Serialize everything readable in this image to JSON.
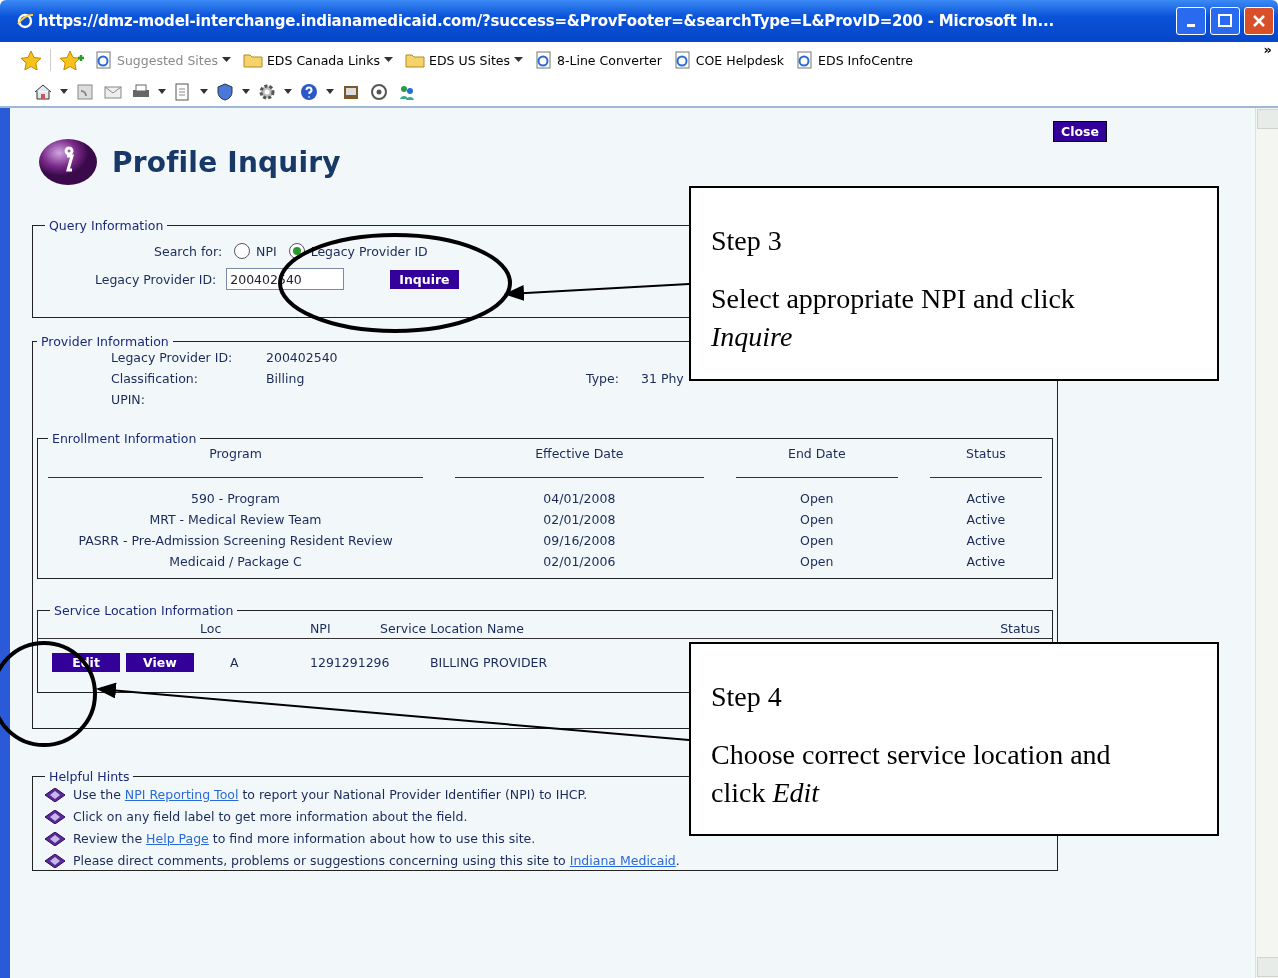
{
  "window": {
    "title": "https://dmz-model-interchange.indianamedicaid.com/?success=&ProvFooter=&searchType=L&ProvID=200 - Microsoft In..."
  },
  "favorites_bar": {
    "items": [
      {
        "label": "Suggested Sites",
        "kind": "page",
        "menu": true,
        "disabled": true
      },
      {
        "label": "EDS Canada Links",
        "kind": "folder",
        "menu": true,
        "disabled": false
      },
      {
        "label": "EDS US Sites",
        "kind": "folder",
        "menu": true,
        "disabled": false
      },
      {
        "label": "8-Line Converter",
        "kind": "page",
        "menu": false,
        "disabled": false
      },
      {
        "label": "COE Helpdesk",
        "kind": "page",
        "menu": false,
        "disabled": false
      },
      {
        "label": "EDS InfoCentre",
        "kind": "page",
        "menu": false,
        "disabled": false
      }
    ],
    "overflow": "»"
  },
  "page": {
    "title": "Profile Inquiry",
    "close_button": "Close",
    "query": {
      "legend": "Query Information",
      "search_for_label": "Search for:",
      "radios": [
        {
          "label": "NPI",
          "selected": false
        },
        {
          "label": "Legacy Provider ID",
          "selected": true
        }
      ],
      "field_label": "Legacy Provider ID:",
      "field_value": "200402540",
      "button": "Inquire"
    },
    "provider": {
      "legend": "Provider Information",
      "fields": [
        {
          "label": "Legacy Provider ID:",
          "value": "200402540"
        },
        {
          "label": "Classification:",
          "value": "Billing"
        },
        {
          "label": "UPIN:"
        }
      ],
      "type_label": "Type:",
      "type_value": "31 Phy"
    },
    "enrollment": {
      "legend": "Enrollment Information",
      "columns": [
        "Program",
        "Effective Date",
        "End Date",
        "Status"
      ],
      "rows": [
        [
          "590 - Program",
          "04/01/2008",
          "Open",
          "Active"
        ],
        [
          "MRT - Medical Review Team",
          "02/01/2008",
          "Open",
          "Active"
        ],
        [
          "PASRR - Pre-Admission Screening Resident Review",
          "09/16/2008",
          "Open",
          "Active"
        ],
        [
          "Medicaid / Package C",
          "02/01/2006",
          "Open",
          "Active"
        ]
      ]
    },
    "service_location": {
      "legend": "Service Location Information",
      "columns": [
        "Loc",
        "NPI",
        "Service Location Name",
        "Status"
      ],
      "rows": [
        {
          "buttons": [
            "Edit",
            "View"
          ],
          "loc": "A",
          "npi": "1291291296",
          "name": "BILLING PROVIDER"
        }
      ]
    },
    "hints": {
      "legend": "Helpful Hints",
      "items": [
        [
          {
            "text": "Use the "
          },
          {
            "link": "NPI Reporting Tool"
          },
          {
            "text": " to report your National Provider Identifier (NPI) to IHCP."
          }
        ],
        [
          {
            "text": "Click on any field label to get more information about  the field."
          }
        ],
        [
          {
            "text": "Review the "
          },
          {
            "link": "Help Page"
          },
          {
            "text": " to find more information about how to use this site."
          }
        ],
        [
          {
            "text": "Please direct comments, problems or suggestions concerning using this site to "
          },
          {
            "link": "Indiana Medicaid"
          },
          {
            "text": "."
          }
        ]
      ]
    }
  },
  "callouts": [
    {
      "heading": "Step 3",
      "body": "Select appropriate NPI and click *Inquire*"
    },
    {
      "heading": "Step 4",
      "body": "Choose correct service location and click *Edit*"
    }
  ]
}
